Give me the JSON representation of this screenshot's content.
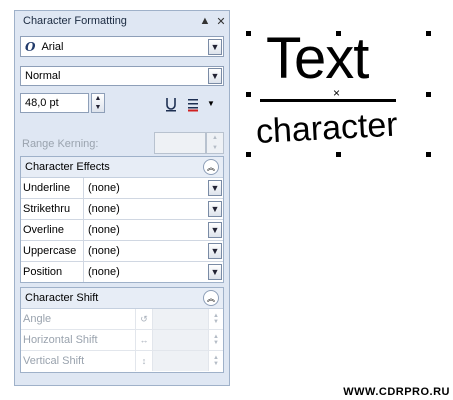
{
  "panel": {
    "title": "Character Formatting",
    "font_name": "Arial",
    "font_style": "Normal",
    "font_size": "48,0 pt",
    "range_kerning_label": "Range Kerning:",
    "effects": {
      "title": "Character Effects",
      "rows": [
        {
          "name": "Underline",
          "value": "(none)"
        },
        {
          "name": "Strikethru",
          "value": "(none)"
        },
        {
          "name": "Overline",
          "value": "(none)"
        },
        {
          "name": "Uppercase",
          "value": "(none)"
        },
        {
          "name": "Position",
          "value": "(none)"
        }
      ]
    },
    "shift": {
      "title": "Character Shift",
      "rows": [
        {
          "name": "Angle"
        },
        {
          "name": "Horizontal Shift"
        },
        {
          "name": "Vertical Shift"
        }
      ]
    }
  },
  "canvas": {
    "text_line1": "Text",
    "text_line2": "character"
  },
  "watermark": "WWW.CDRPRO.RU",
  "colors": {
    "panel_bg": "#dfe7f3",
    "panel_border": "#9fb1c9",
    "disabled_text": "#9aa3ae"
  }
}
